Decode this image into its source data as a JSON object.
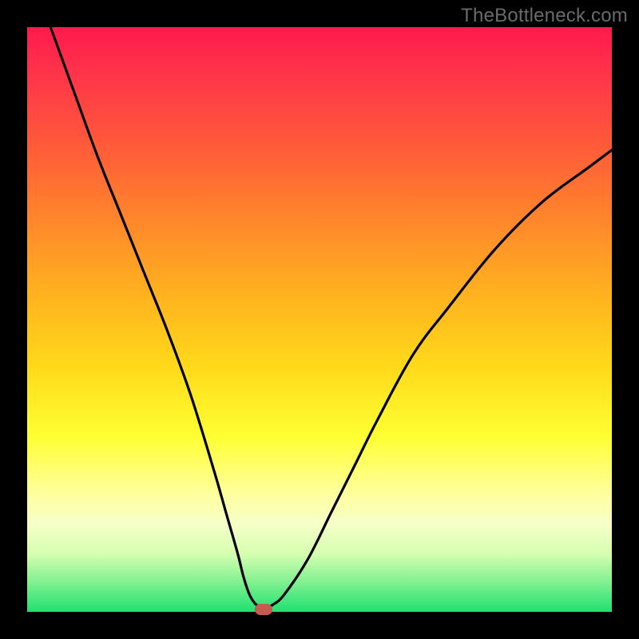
{
  "watermark": "TheBottleneck.com",
  "chart_data": {
    "type": "line",
    "title": "",
    "xlabel": "",
    "ylabel": "",
    "xlim": [
      0,
      100
    ],
    "ylim": [
      0,
      100
    ],
    "grid": false,
    "legend": false,
    "series": [
      {
        "name": "curve",
        "x": [
          4,
          8,
          12,
          16,
          20,
          24,
          28,
          32,
          34,
          36,
          37,
          38,
          39,
          40,
          41,
          42,
          44,
          48,
          52,
          56,
          60,
          66,
          72,
          80,
          88,
          96,
          100
        ],
        "y": [
          100,
          89,
          78,
          68,
          58,
          48,
          37,
          24,
          17,
          10,
          6,
          3,
          1.4,
          0.8,
          0.8,
          1.2,
          3,
          9,
          17,
          25,
          33,
          44,
          52,
          62,
          70,
          76,
          79
        ]
      }
    ],
    "marker": {
      "x": 40.5,
      "y": 0.4
    },
    "gradient_stops": [
      {
        "pos": 0,
        "color": "#ff1a4d"
      },
      {
        "pos": 10,
        "color": "#ff3a47"
      },
      {
        "pos": 22,
        "color": "#ff6037"
      },
      {
        "pos": 34,
        "color": "#ff8a2a"
      },
      {
        "pos": 46,
        "color": "#ffb31f"
      },
      {
        "pos": 58,
        "color": "#ffd91a"
      },
      {
        "pos": 70,
        "color": "#ffff33"
      },
      {
        "pos": 80,
        "color": "#ffffa0"
      },
      {
        "pos": 85,
        "color": "#f6ffc8"
      },
      {
        "pos": 90,
        "color": "#d6ffb0"
      },
      {
        "pos": 95,
        "color": "#80f090"
      },
      {
        "pos": 100,
        "color": "#1ee070"
      }
    ]
  }
}
